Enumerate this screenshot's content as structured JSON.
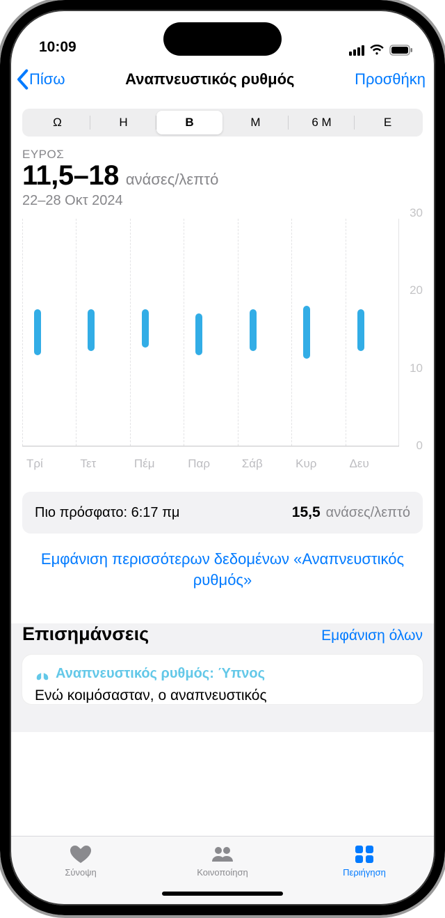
{
  "status": {
    "time": "10:09"
  },
  "nav": {
    "back": "Πίσω",
    "title": "Αναπνευστικός ρυθμός",
    "add": "Προσθήκη"
  },
  "segments": [
    "Ω",
    "Η",
    "Β",
    "Μ",
    "6 Μ",
    "Ε"
  ],
  "segment_selected_index": 2,
  "range": {
    "label": "ΕΥΡΟΣ",
    "value": "11,5–18",
    "unit": "ανάσες/λεπτό",
    "date": "22–28 Οκτ 2024"
  },
  "chart_data": {
    "type": "range-bar",
    "ylim": [
      0,
      30
    ],
    "yticks": [
      0,
      10,
      20,
      30
    ],
    "categories": [
      "Τρί",
      "Τετ",
      "Πέμ",
      "Παρ",
      "Σάβ",
      "Κυρ",
      "Δευ"
    ],
    "series": [
      {
        "low": 12.0,
        "high": 18.0
      },
      {
        "low": 12.5,
        "high": 18.0
      },
      {
        "low": 13.0,
        "high": 18.0
      },
      {
        "low": 12.0,
        "high": 17.5
      },
      {
        "low": 12.5,
        "high": 18.0
      },
      {
        "low": 11.5,
        "high": 18.5
      },
      {
        "low": 12.5,
        "high": 18.0
      }
    ]
  },
  "latest": {
    "label": "Πιο πρόσφατο: 6:17 πμ",
    "value": "15,5",
    "unit": "ανάσες/λεπτό"
  },
  "more_link": "Εμφάνιση περισσότερων δεδομένων «Αναπνευστικός ρυθμός»",
  "highlights": {
    "title": "Επισημάνσεις",
    "show_all": "Εμφάνιση όλων",
    "card_title": "Αναπνευστικός ρυθμός: Ύπνος",
    "card_body": "Ενώ κοιμόσασταν, ο αναπνευστικός"
  },
  "tabs": {
    "summary": "Σύνοψη",
    "sharing": "Κοινοποίηση",
    "browse": "Περιήγηση"
  },
  "colors": {
    "accent": "#007aff",
    "chart_bar": "#32ade6"
  }
}
